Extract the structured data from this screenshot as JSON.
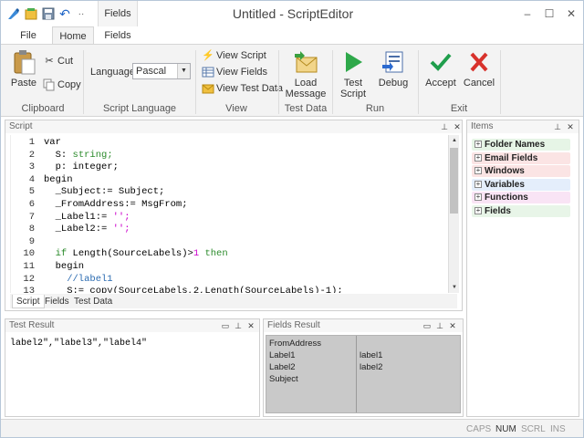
{
  "window": {
    "title": "Untitled - ScriptEditor",
    "contextual_tab": "Fields"
  },
  "ribbon_tabs": [
    {
      "label": "File"
    },
    {
      "label": "Home"
    },
    {
      "label": "Fields"
    }
  ],
  "clipboard": {
    "paste": "Paste",
    "cut": "Cut",
    "copy": "Copy",
    "group_label": "Clipboard"
  },
  "script_language": {
    "label": "Language",
    "selected": "Pascal",
    "group_label": "Script Language"
  },
  "view": {
    "view_script": "View Script",
    "view_fields": "View Fields",
    "view_test_data": "View Test Data",
    "group_label": "View"
  },
  "test_data": {
    "load_message_line1": "Load",
    "load_message_line2": "Message",
    "group_label": "Test Data"
  },
  "run": {
    "test_script_line1": "Test",
    "test_script_line2": "Script",
    "debug": "Debug",
    "group_label": "Run"
  },
  "exit": {
    "accept": "Accept",
    "cancel": "Cancel",
    "group_label": "Exit"
  },
  "script_panel": {
    "title": "Script",
    "lines": [
      {
        "n": "1",
        "segments": [
          {
            "t": "var",
            "c": "#000"
          }
        ]
      },
      {
        "n": "2",
        "segments": [
          {
            "t": "  S: ",
            "c": "#000"
          },
          {
            "t": "string;",
            "c": "#2a8a2a"
          }
        ]
      },
      {
        "n": "3",
        "segments": [
          {
            "t": "  p: integer;",
            "c": "#000"
          }
        ]
      },
      {
        "n": "4",
        "segments": [
          {
            "t": "begin",
            "c": "#000"
          }
        ]
      },
      {
        "n": "5",
        "segments": [
          {
            "t": "  _Subject:= Subject;",
            "c": "#000"
          }
        ]
      },
      {
        "n": "6",
        "segments": [
          {
            "t": "  _FromAddress:= MsgFrom;",
            "c": "#000"
          }
        ]
      },
      {
        "n": "7",
        "segments": [
          {
            "t": "  _Label1:= ",
            "c": "#000"
          },
          {
            "t": "'';",
            "c": "#cc00cc"
          }
        ]
      },
      {
        "n": "8",
        "segments": [
          {
            "t": "  _Label2:= ",
            "c": "#000"
          },
          {
            "t": "'';",
            "c": "#cc00cc"
          }
        ]
      },
      {
        "n": "9",
        "segments": [
          {
            "t": "",
            "c": "#000"
          }
        ]
      },
      {
        "n": "10",
        "segments": [
          {
            "t": "  if ",
            "c": "#2a8a2a"
          },
          {
            "t": "Length(SourceLabels)>",
            "c": "#000"
          },
          {
            "t": "1",
            "c": "#cc00cc"
          },
          {
            "t": " then",
            "c": "#2a8a2a"
          }
        ]
      },
      {
        "n": "11",
        "segments": [
          {
            "t": "  begin",
            "c": "#000"
          }
        ]
      },
      {
        "n": "12",
        "segments": [
          {
            "t": "    //label1",
            "c": "#2a6ab0"
          }
        ]
      },
      {
        "n": "13",
        "segments": [
          {
            "t": "    S:= copy(SourceLabels,2,Length(SourceLabels)-1);",
            "c": "#000"
          }
        ]
      }
    ],
    "tabs": [
      {
        "label": "Script"
      },
      {
        "label": "Fields"
      },
      {
        "label": "Test Data"
      }
    ]
  },
  "test_result_panel": {
    "title": "Test Result",
    "text": "label2\",\"label3\",\"label4\""
  },
  "fields_result_panel": {
    "title": "Fields Result",
    "rows": [
      {
        "name": "FromAddress",
        "value": ""
      },
      {
        "name": "Label1",
        "value": "label1"
      },
      {
        "name": "Label2",
        "value": "label2"
      },
      {
        "name": "Subject",
        "value": ""
      }
    ]
  },
  "items_panel": {
    "title": "Items",
    "items": [
      {
        "label": "Folder Names",
        "color": "#e6f5e6"
      },
      {
        "label": "Email Fields",
        "color": "#fbe4e4"
      },
      {
        "label": "Windows",
        "color": "#fbe4e4"
      },
      {
        "label": "Variables",
        "color": "#e4eefb"
      },
      {
        "label": "Functions",
        "color": "#f9e4f5"
      },
      {
        "label": "Fields",
        "color": "#e8f5e8"
      }
    ]
  },
  "status_bar": {
    "caps": "CAPS",
    "num": "NUM",
    "scrl": "SCRL",
    "ins": "INS"
  }
}
